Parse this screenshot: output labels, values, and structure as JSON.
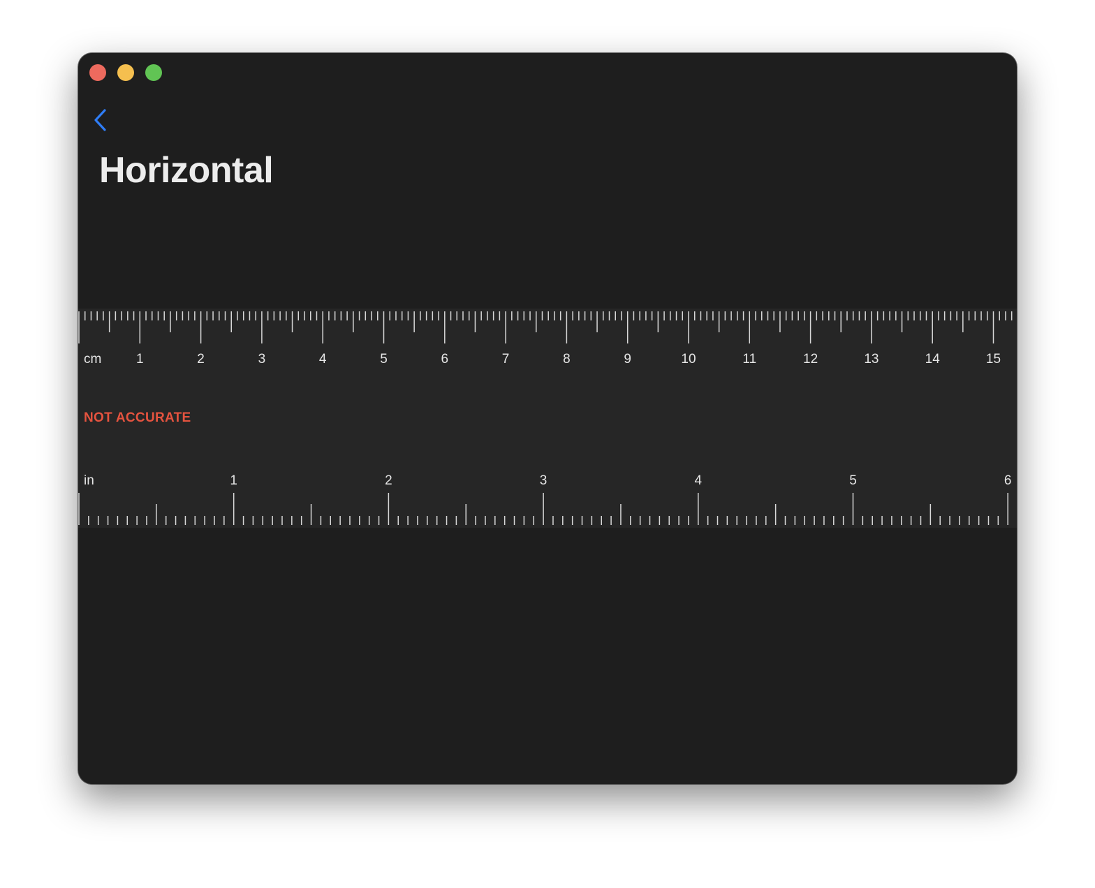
{
  "window": {
    "controls": [
      "close",
      "minimize",
      "zoom"
    ]
  },
  "nav": {
    "back_icon": "chevron-left-icon"
  },
  "page": {
    "title": "Horizontal"
  },
  "warning": {
    "text": "NOT ACCURATE"
  },
  "rulers": {
    "cm": {
      "unit_label": "cm",
      "labels": [
        "1",
        "2",
        "3",
        "4",
        "5",
        "6",
        "7",
        "8",
        "9",
        "10",
        "11",
        "12",
        "13",
        "14",
        "15"
      ],
      "subdivisions": 10
    },
    "in": {
      "unit_label": "in",
      "labels": [
        "1",
        "2",
        "3",
        "4",
        "5",
        "6"
      ],
      "subdivisions": 16
    }
  },
  "colors": {
    "window_bg": "#1e1e1e",
    "ruler_band_bg": "#262626",
    "tick": "#d8d8d8",
    "warning": "#e5533f",
    "accent": "#2f7df6",
    "close": "#ed6a5e",
    "minimize": "#f5bf4f",
    "zoom": "#61c454"
  }
}
